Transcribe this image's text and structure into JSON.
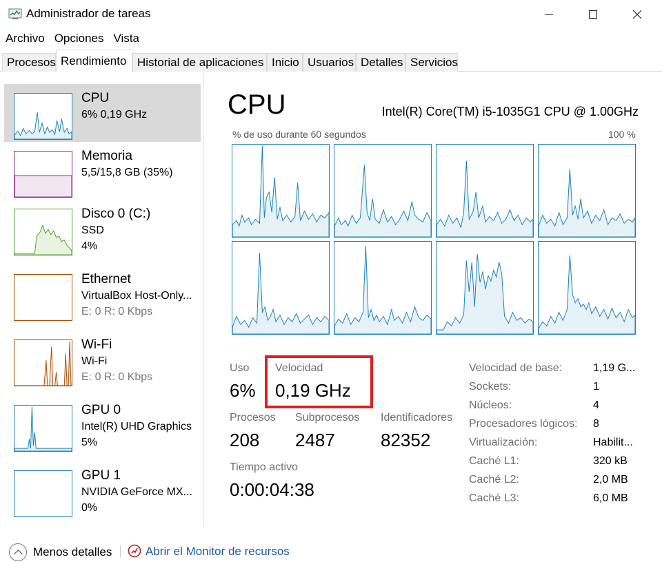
{
  "window": {
    "title": "Administrador de tareas",
    "minimize": "—",
    "maximize": "☐",
    "close": "✕"
  },
  "menu": [
    "Archivo",
    "Opciones",
    "Vista"
  ],
  "tabs": [
    "Procesos",
    "Rendimiento",
    "Historial de aplicaciones",
    "Inicio",
    "Usuarios",
    "Detalles",
    "Servicios"
  ],
  "sidebar": {
    "items": [
      {
        "title": "CPU",
        "sub1": "6%  0,19 GHz",
        "sub2": ""
      },
      {
        "title": "Memoria",
        "sub1": "5,5/15,8 GB (35%)",
        "sub2": ""
      },
      {
        "title": "Disco 0 (C:)",
        "sub1": "SSD",
        "sub2": "4%"
      },
      {
        "title": "Ethernet",
        "sub1": "VirtualBox Host-Only...",
        "sub2": "E: 0  R: 0 Kbps"
      },
      {
        "title": "Wi-Fi",
        "sub1": "Wi-Fi",
        "sub2": "E: 0  R: 0 Kbps"
      },
      {
        "title": "GPU 0",
        "sub1": "Intel(R) UHD Graphics",
        "sub2": "5%"
      },
      {
        "title": "GPU 1",
        "sub1": "NVIDIA GeForce MX...",
        "sub2": "0%"
      }
    ]
  },
  "main": {
    "title": "CPU",
    "model": "Intel(R) Core(TM) i5-1035G1 CPU @ 1.00GHz",
    "graph_caption": "% de uso durante 60 segundos",
    "graph_max": "100 %",
    "stats": {
      "uso_label": "Uso",
      "uso_value": "6%",
      "velocidad_label": "Velocidad",
      "velocidad_value": "0,19 GHz",
      "procesos_label": "Procesos",
      "procesos_value": "208",
      "subprocesos_label": "Subprocesos",
      "subprocesos_value": "2487",
      "identificadores_label": "Identificadores",
      "identificadores_value": "82352",
      "tiempo_label": "Tiempo activo",
      "tiempo_value": "0:00:04:38"
    },
    "details": [
      {
        "label": "Velocidad de base:",
        "value": "1,19 G..."
      },
      {
        "label": "Sockets:",
        "value": "1"
      },
      {
        "label": "Núcleos:",
        "value": "4"
      },
      {
        "label": "Procesadores lógicos:",
        "value": "8"
      },
      {
        "label": "Virtualización:",
        "value": "Habilit..."
      },
      {
        "label": "Caché L1:",
        "value": "320 kB"
      },
      {
        "label": "Caché L2:",
        "value": "2,0 MB"
      },
      {
        "label": "Caché L3:",
        "value": "6,0 MB"
      }
    ]
  },
  "footer": {
    "less_details": "Menos detalles",
    "resource_monitor": "Abrir el Monitor de recursos"
  },
  "colors": {
    "cpu": "#1b82b7",
    "memory": "#8b1c8b",
    "disk": "#4da02a",
    "ethernet": "#a74f01",
    "wifi": "#a74f01",
    "gpu": "#1b82b7",
    "highlight": "#e0201e",
    "link": "#1a5aa6"
  },
  "icons": {
    "app": "task-manager-icon",
    "less": "chevron-up-icon",
    "monitor": "resource-monitor-icon"
  }
}
